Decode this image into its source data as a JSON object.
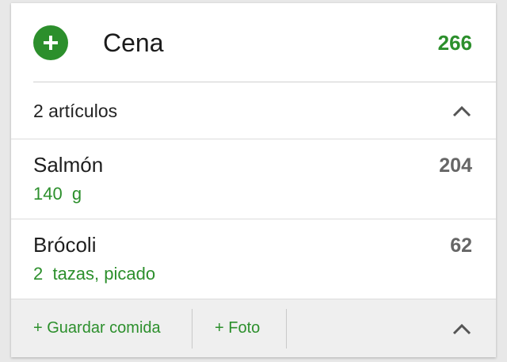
{
  "meal": {
    "title": "Cena",
    "total_calories": "266",
    "add_icon": "plus-circle-icon"
  },
  "items_summary": {
    "count_label": "2 artículos",
    "collapse_icon": "chevron-up-icon"
  },
  "foods": [
    {
      "name": "Salmón",
      "detail": "140  g",
      "calories": "204"
    },
    {
      "name": "Brócoli",
      "detail": "2  tazas, picado",
      "calories": "62"
    }
  ],
  "footer": {
    "save_meal_label": "+ Guardar comida",
    "photo_label": "+ Foto",
    "collapse_icon": "chevron-up-icon"
  },
  "colors": {
    "accent": "#2c8f2c",
    "calorie_gray": "#666666",
    "footer_bg": "#efefef"
  }
}
